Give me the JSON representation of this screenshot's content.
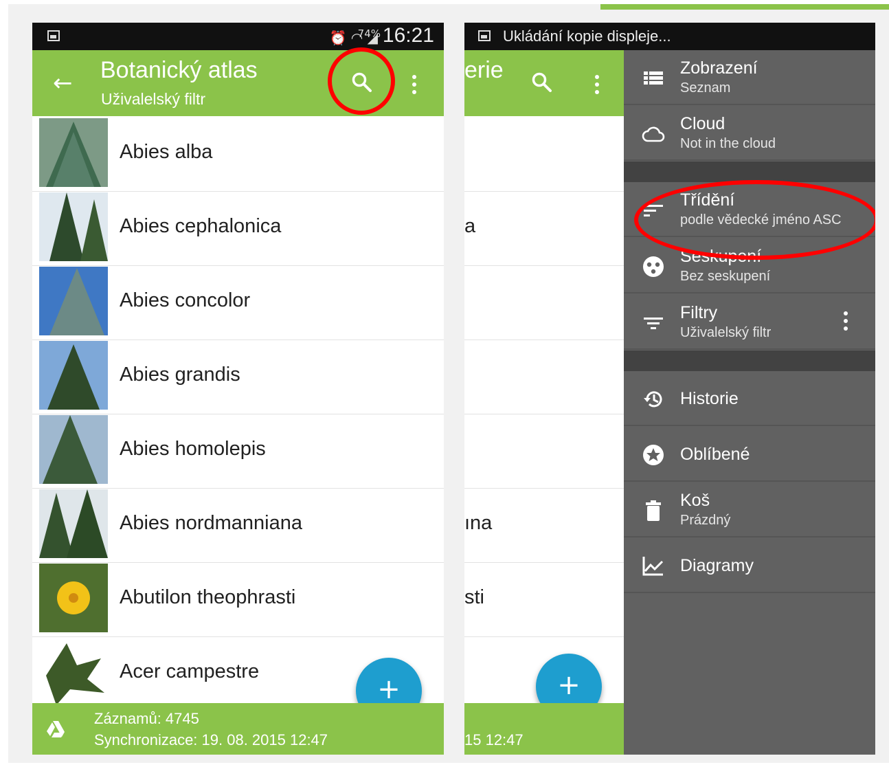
{
  "left": {
    "status_bar": {
      "battery": "74%",
      "time": "16:21"
    },
    "appbar": {
      "title": "Botanický atlas",
      "subtitle": "Uživalelský filtr"
    },
    "items": [
      {
        "label": "Abies alba"
      },
      {
        "label": "Abies cephalonica"
      },
      {
        "label": "Abies concolor"
      },
      {
        "label": "Abies grandis"
      },
      {
        "label": "Abies homolepis"
      },
      {
        "label": "Abies nordmanniana"
      },
      {
        "label": "Abutilon theophrasti"
      },
      {
        "label": "Acer campestre"
      }
    ],
    "fab": "+",
    "footer": {
      "records": "Záznamů: 4745",
      "sync": "Synchronizace: 19. 08. 2015 12:47"
    }
  },
  "right": {
    "status_bar": {
      "notification": "Ukládání kopie displeje..."
    },
    "appbar": {
      "title_fragment": "erie"
    },
    "list_fragments": [
      "",
      "a",
      "",
      "",
      "",
      "ına",
      "sti",
      ""
    ],
    "fab": "+",
    "footer": {
      "sync_fragment": "15 12:47"
    },
    "drawer": [
      {
        "title": "Zobrazení",
        "subtitle": "Seznam",
        "icon": "list-icon"
      },
      {
        "title": "Cloud",
        "subtitle": "Not in the cloud",
        "icon": "cloud-icon"
      },
      {
        "title": "Třídění",
        "subtitle": "podle vědecké jméno ASC",
        "icon": "sort-icon"
      },
      {
        "title": "Seskupení",
        "subtitle": "Bez seskupení",
        "icon": "group-icon"
      },
      {
        "title": "Filtry",
        "subtitle": "Uživalelský filtr",
        "icon": "filter-icon"
      },
      {
        "title": "Historie",
        "icon": "history-icon"
      },
      {
        "title": "Oblíbené",
        "icon": "star-icon"
      },
      {
        "title": "Koš",
        "subtitle": "Prázdný",
        "icon": "trash-icon"
      },
      {
        "title": "Diagramy",
        "icon": "chart-icon"
      }
    ]
  },
  "colors": {
    "appbar": "#8bc34a",
    "fab": "#1e9ecf",
    "drawer": "#616161",
    "highlight": "#ff0000"
  }
}
